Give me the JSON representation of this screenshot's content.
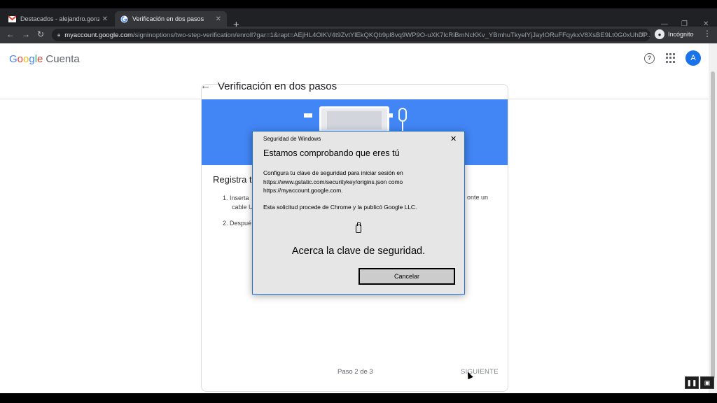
{
  "browser": {
    "tabs": [
      {
        "title": "Destacados - alejandro.gonzalez",
        "close": "✕"
      },
      {
        "title": "Verificación en dos pasos",
        "close": "✕"
      }
    ],
    "new_tab": "+",
    "window_controls": [
      "—",
      "❐",
      "✕"
    ],
    "url_host": "myaccount.google.com",
    "url_path": "/signinoptions/two-step-verification/enroll?gar=1&rapt=AEjHL4OlKV4t9ZvtYlEkQKQb9pl8vq9WP9O-uXK7lcRiBmNcKKv_YBmhuTkyelYjJayIORuFFqykxV8XsBE9Lt0G0xUhDP...",
    "incognito_label": "Incógnito"
  },
  "header": {
    "logo": "Google",
    "product": "Cuenta",
    "help": "?",
    "avatar_letter": "A",
    "page_title": "Verificación en dos pasos"
  },
  "card": {
    "heading": "Registra t",
    "step1_a": "1. Inserta",
    "step1_b": "cable U",
    "step1_tail": "onte un",
    "step2": "2. Despué",
    "footer_step": "Paso 2 de 3",
    "footer_next": "SIGUIENTE"
  },
  "dialog": {
    "caption": "Seguridad de Windows",
    "close": "✕",
    "heading": "Estamos comprobando que eres tú",
    "body": "Configura tu clave de seguridad para iniciar sesión en https://www.gstatic.com/securitykey/origins.json como https://myaccount.google.com.",
    "note": "Esta solicitud procede de Chrome y la publicó Google LLC.",
    "prompt": "Acerca la clave de seguridad.",
    "cancel": "Cancelar"
  },
  "colors": {
    "accent_blue": "#4285f4",
    "avatar_blue": "#1a73e8",
    "dialog_border": "#1e74d4"
  }
}
